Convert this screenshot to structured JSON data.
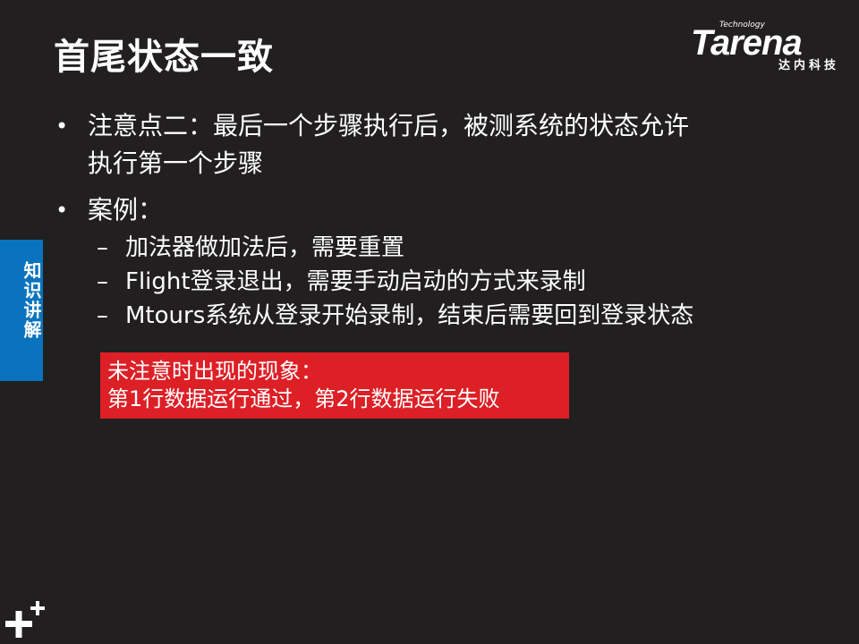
{
  "title": "首尾状态一致",
  "logo": {
    "small": "Technology",
    "main": "Tarena",
    "sub": "达内科技"
  },
  "bullets": [
    {
      "text": "注意点二：最后一个步骤执行后，被测系统的状态允许执行第一个步骤",
      "line1": "注意点二：最后一个步骤执行后，被测系统的状态允许",
      "line2": "执行第一个步骤"
    },
    {
      "text": "案例：",
      "sub": [
        "加法器做加法后，需要重置",
        "Flight登录退出，需要手动启动的方式来录制",
        "Mtours系统从登录开始录制，结束后需要回到登录状态"
      ]
    }
  ],
  "side_tab": {
    "label": "知识讲解",
    "color": "#0a73bd"
  },
  "note": {
    "line1": "未注意时出现的现象：",
    "line2": "第1行数据运行通过，第2行数据运行失败",
    "color": "#dd1f26"
  },
  "colors": {
    "background": "#221f20",
    "text": "#ffffff"
  },
  "icons": {
    "plus_mark": "plus-icon"
  }
}
